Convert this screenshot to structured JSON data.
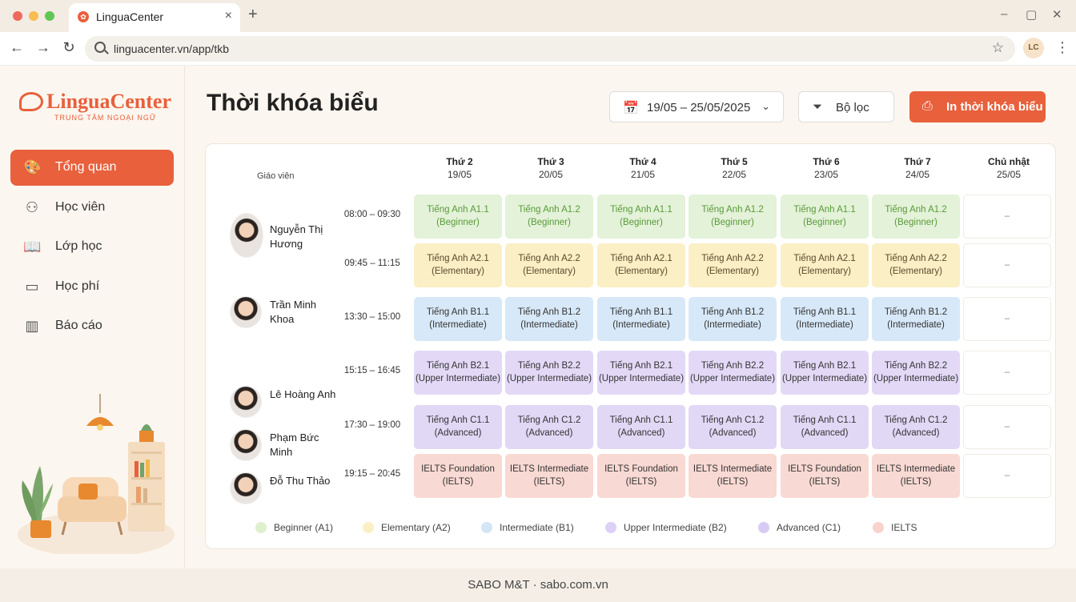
{
  "browser": {
    "tab_title": "LinguaCenter",
    "url": "linguacenter.vn/app/tkb",
    "profile_initials": "LC"
  },
  "brand": {
    "name": "LinguaCenter",
    "tagline": "TRUNG TÂM NGOẠI NGỮ",
    "accent": "#e8603c"
  },
  "sidebar": {
    "items": [
      {
        "label": "Tổng quan",
        "icon": "palette-icon",
        "active": true
      },
      {
        "label": "Học viên",
        "icon": "users-icon",
        "active": false
      },
      {
        "label": "Lớp học",
        "icon": "book-icon",
        "active": false
      },
      {
        "label": "Học phí",
        "icon": "wallet-icon",
        "active": false
      },
      {
        "label": "Báo cáo",
        "icon": "bar-chart-icon",
        "active": false
      }
    ]
  },
  "header": {
    "title": "Thời khóa biểu",
    "date_range": "19/05 – 25/05/2025",
    "filter_label": "Bộ lọc",
    "print_label": "In thời khóa biểu"
  },
  "schedule": {
    "teacher_header": "Giáo viên",
    "days": [
      {
        "day": "Thứ 2",
        "date": "19/05"
      },
      {
        "day": "Thứ 3",
        "date": "20/05"
      },
      {
        "day": "Thứ 4",
        "date": "21/05"
      },
      {
        "day": "Thứ 5",
        "date": "22/05"
      },
      {
        "day": "Thứ 6",
        "date": "23/05"
      },
      {
        "day": "Thứ 7",
        "date": "24/05"
      },
      {
        "day": "Chủ nhật",
        "date": "25/05"
      }
    ],
    "teachers": [
      {
        "name": "Nguyễn Thị Hương"
      },
      {
        "name": "Trần Minh Khoa"
      },
      {
        "name": "Lê Hoàng Anh"
      },
      {
        "name": "Phạm Bức Minh"
      },
      {
        "name": "Đỗ Thu Thảo"
      }
    ],
    "rows": [
      {
        "time": "08:00 – 09:30",
        "level": "A1",
        "cells": [
          {
            "name": "Tiếng Anh A1.1",
            "level": "(Beginner)"
          },
          {
            "name": "Tiếng Anh A1.2",
            "level": "(Beginner)"
          },
          {
            "name": "Tiếng Anh A1.1",
            "level": "(Beginner)"
          },
          {
            "name": "Tiếng Anh A1.2",
            "level": "(Beginner)"
          },
          {
            "name": "Tiếng Anh A1.1",
            "level": "(Beginner)"
          },
          {
            "name": "Tiếng Anh A1.2",
            "level": "(Beginner)"
          }
        ]
      },
      {
        "time": "09:45 – 11:15",
        "level": "A2",
        "cells": [
          {
            "name": "Tiếng Anh A2.1",
            "level": "(Elementary)"
          },
          {
            "name": "Tiếng Anh A2.2",
            "level": "(Elementary)"
          },
          {
            "name": "Tiếng Anh A2.1",
            "level": "(Elementary)"
          },
          {
            "name": "Tiếng Anh A2.2",
            "level": "(Elementary)"
          },
          {
            "name": "Tiếng Anh A2.1",
            "level": "(Elementary)"
          },
          {
            "name": "Tiếng Anh A2.2",
            "level": "(Elementary)"
          }
        ]
      },
      {
        "time": "13:30 – 15:00",
        "level": "B1",
        "cells": [
          {
            "name": "Tiếng Anh B1.1",
            "level": "(Intermediate)"
          },
          {
            "name": "Tiếng Anh B1.2",
            "level": "(Intermediate)"
          },
          {
            "name": "Tiếng Anh B1.1",
            "level": "(Intermediate)"
          },
          {
            "name": "Tiếng Anh B1.2",
            "level": "(Intermediate)"
          },
          {
            "name": "Tiếng Anh B1.1",
            "level": "(Intermediate)"
          },
          {
            "name": "Tiếng Anh B1.2",
            "level": "(Intermediate)"
          }
        ]
      },
      {
        "time": "15:15 – 16:45",
        "level": "B2",
        "cells": [
          {
            "name": "Tiếng Anh B2.1",
            "level": "(Upper Intermediate)"
          },
          {
            "name": "Tiếng Anh B2.2",
            "level": "(Upper Intermediate)"
          },
          {
            "name": "Tiếng Anh B2.1",
            "level": "(Upper Intermediate)"
          },
          {
            "name": "Tiếng Anh B2.2",
            "level": "(Upper Intermediate)"
          },
          {
            "name": "Tiếng Anh B2.1",
            "level": "(Upper Intermediate)"
          },
          {
            "name": "Tiếng Anh B2.2",
            "level": "(Upper Intermediate)"
          }
        ]
      },
      {
        "time": "17:30 – 19:00",
        "level": "C1",
        "cells": [
          {
            "name": "Tiếng Anh C1.1",
            "level": "(Advanced)"
          },
          {
            "name": "Tiếng Anh C1.2",
            "level": "(Advanced)"
          },
          {
            "name": "Tiếng Anh C1.1",
            "level": "(Advanced)"
          },
          {
            "name": "Tiếng Anh C1.2",
            "level": "(Advanced)"
          },
          {
            "name": "Tiếng Anh C1.1",
            "level": "(Advanced)"
          },
          {
            "name": "Tiếng Anh C1.2",
            "level": "(Advanced)"
          }
        ]
      },
      {
        "time": "19:15 – 20:45",
        "level": "IE",
        "cells": [
          {
            "name": "IELTS Foundation",
            "level": "(IELTS)"
          },
          {
            "name": "IELTS Intermediate",
            "level": "(IELTS)"
          },
          {
            "name": "IELTS Foundation",
            "level": "(IELTS)"
          },
          {
            "name": "IELTS Intermediate",
            "level": "(IELTS)"
          },
          {
            "name": "IELTS Foundation",
            "level": "(IELTS)"
          },
          {
            "name": "IELTS Intermediate",
            "level": "(IELTS)"
          }
        ]
      }
    ],
    "sunday_placeholder": "–"
  },
  "legend": [
    {
      "label": "Beginner (A1)",
      "color": "#dff0cf"
    },
    {
      "label": "Elementary (A2)",
      "color": "#fbefc5"
    },
    {
      "label": "Intermediate (B1)",
      "color": "#d3e6f8"
    },
    {
      "label": "Upper Intermediate (B2)",
      "color": "#ddd0f6"
    },
    {
      "label": "Advanced (C1)",
      "color": "#d8cbf3"
    },
    {
      "label": "IELTS",
      "color": "#f9d3cc"
    }
  ],
  "footer": {
    "text": "SABO M&T · sabo.com.vn"
  }
}
